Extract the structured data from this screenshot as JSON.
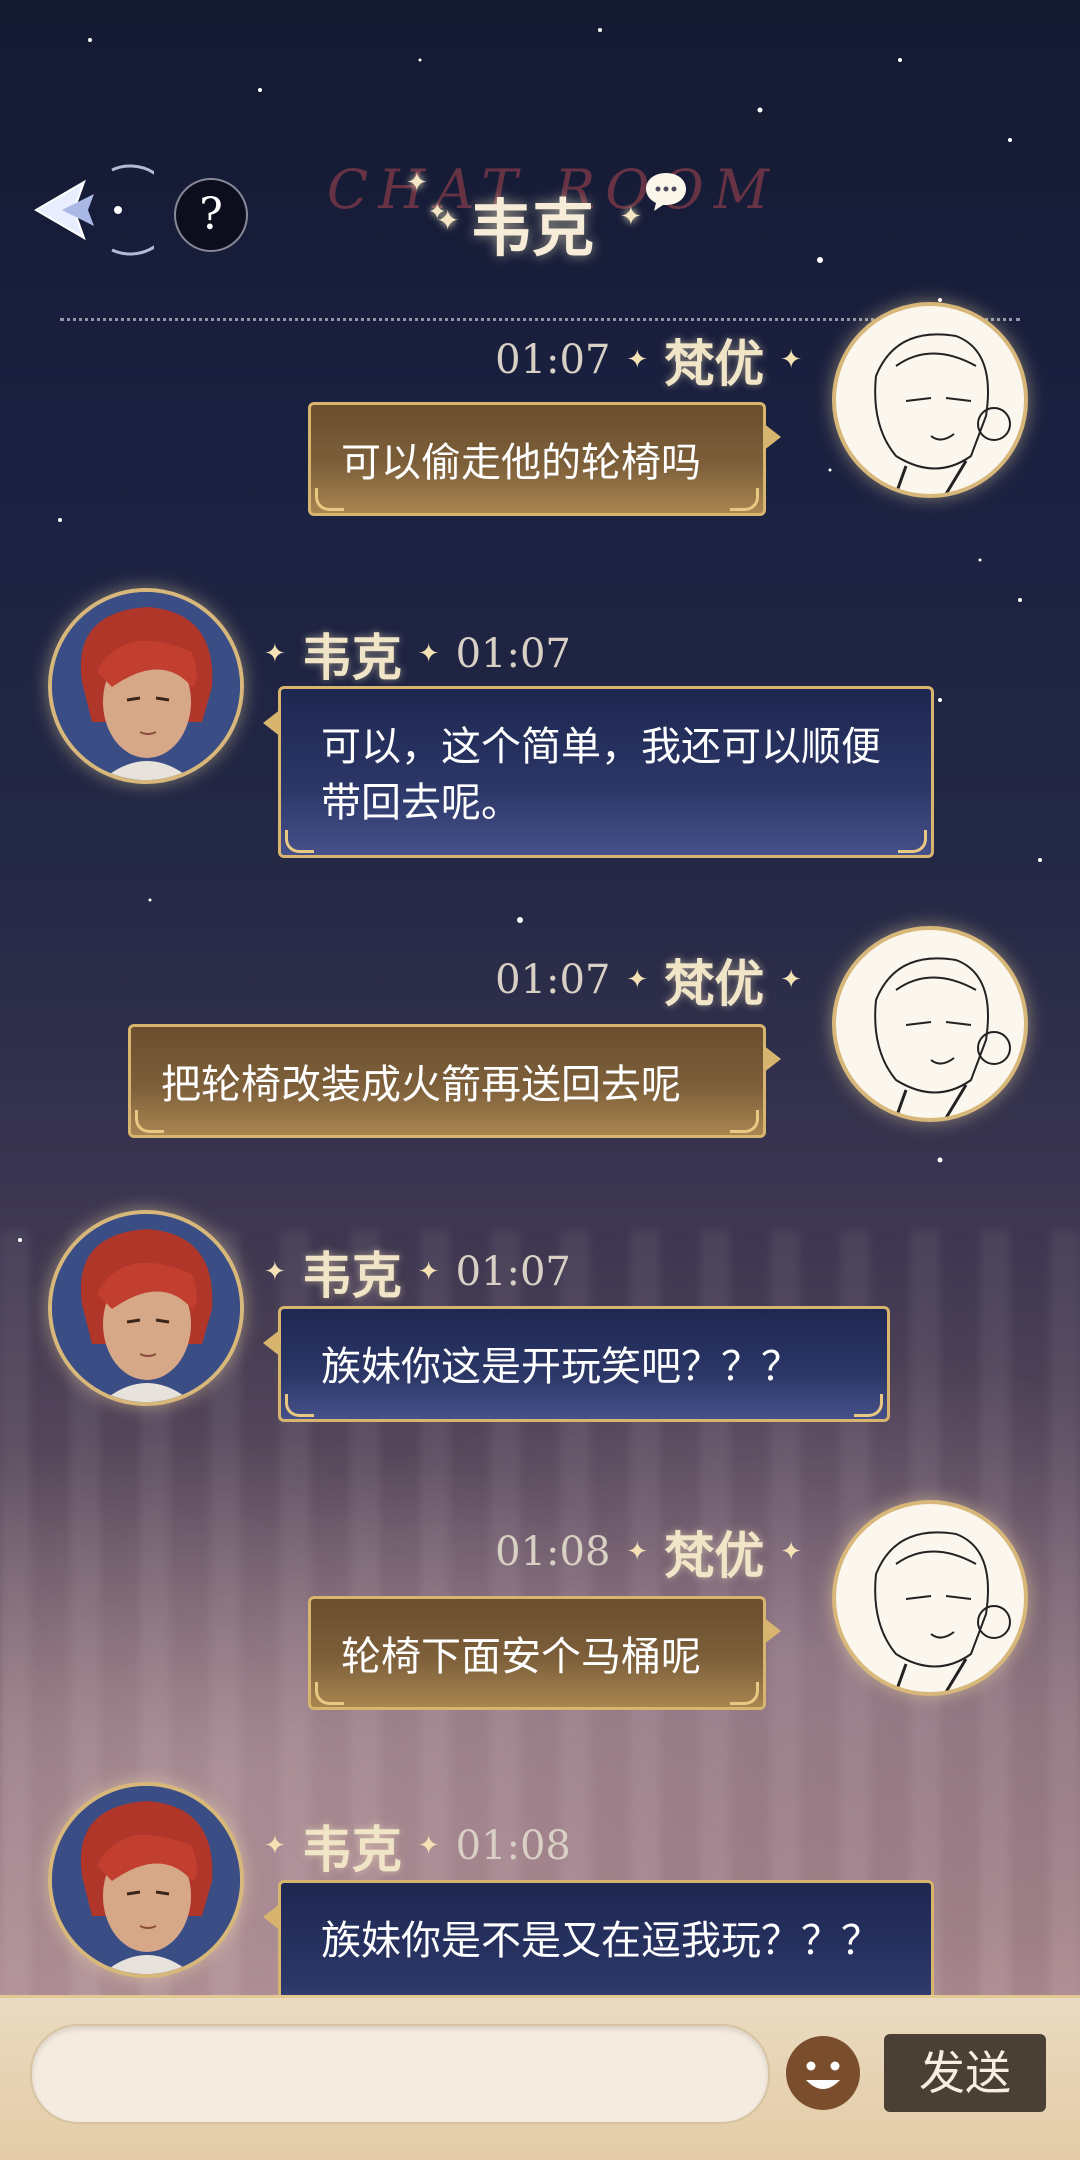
{
  "header": {
    "title": "韦克",
    "watermark": "CHAT ROOM"
  },
  "messages": [
    {
      "side": "right",
      "sender": "梵优",
      "time": "01:07",
      "text": "可以偷走他的轮椅吗"
    },
    {
      "side": "left",
      "sender": "韦克",
      "time": "01:07",
      "text": "可以，这个简单，我还可以顺便带回去呢。"
    },
    {
      "side": "right",
      "sender": "梵优",
      "time": "01:07",
      "text": "把轮椅改装成火箭再送回去呢"
    },
    {
      "side": "left",
      "sender": "韦克",
      "time": "01:07",
      "text": "族妹你这是开玩笑吧？？？"
    },
    {
      "side": "right",
      "sender": "梵优",
      "time": "01:08",
      "text": "轮椅下面安个马桶呢"
    },
    {
      "side": "left",
      "sender": "韦克",
      "time": "01:08",
      "text": "族妹你是不是又在逗我玩？？？"
    }
  ],
  "input": {
    "placeholder": "",
    "send_label": "发送"
  },
  "colors": {
    "right_bubble": "#7d5f3a",
    "left_bubble": "#2c3768",
    "gold_border": "#d7b56e"
  }
}
